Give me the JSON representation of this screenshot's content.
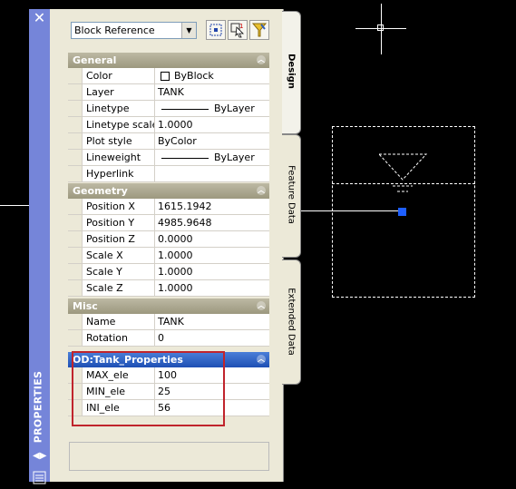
{
  "window": {
    "title": "PROPERTIES",
    "close_label": "✕"
  },
  "toolbar": {
    "object_type": "Block Reference",
    "buttons": [
      "select-objects-icon",
      "pickadd-toggle-icon",
      "quick-select-icon"
    ]
  },
  "tabs": [
    "Design",
    "Feature Data",
    "Extended Data"
  ],
  "sections": {
    "general": {
      "title": "General",
      "rows": [
        {
          "label": "Color",
          "value": "ByBlock"
        },
        {
          "label": "Layer",
          "value": "TANK"
        },
        {
          "label": "Linetype",
          "value": "ByLayer"
        },
        {
          "label": "Linetype scale",
          "value": "1.0000"
        },
        {
          "label": "Plot style",
          "value": "ByColor"
        },
        {
          "label": "Lineweight",
          "value": "ByLayer"
        },
        {
          "label": "Hyperlink",
          "value": ""
        }
      ]
    },
    "geometry": {
      "title": "Geometry",
      "rows": [
        {
          "label": "Position X",
          "value": "1615.1942"
        },
        {
          "label": "Position Y",
          "value": "4985.9648"
        },
        {
          "label": "Position Z",
          "value": "0.0000"
        },
        {
          "label": "Scale X",
          "value": "1.0000"
        },
        {
          "label": "Scale Y",
          "value": "1.0000"
        },
        {
          "label": "Scale Z",
          "value": "1.0000"
        }
      ]
    },
    "misc": {
      "title": "Misc",
      "rows": [
        {
          "label": "Name",
          "value": "TANK"
        },
        {
          "label": "Rotation",
          "value": "0"
        }
      ]
    },
    "od": {
      "title": "OD:Tank_Properties",
      "rows": [
        {
          "label": "MAX_ele",
          "value": "100"
        },
        {
          "label": "MIN_ele",
          "value": "25"
        },
        {
          "label": "INI_ele",
          "value": "56"
        }
      ]
    }
  },
  "colors": {
    "strip": "#7585d9",
    "panel": "#ece9d8",
    "section_header": "#a8a48c",
    "od_header": "#2f62c6",
    "highlight": "#c0242c",
    "grip": "#1e5fff"
  }
}
